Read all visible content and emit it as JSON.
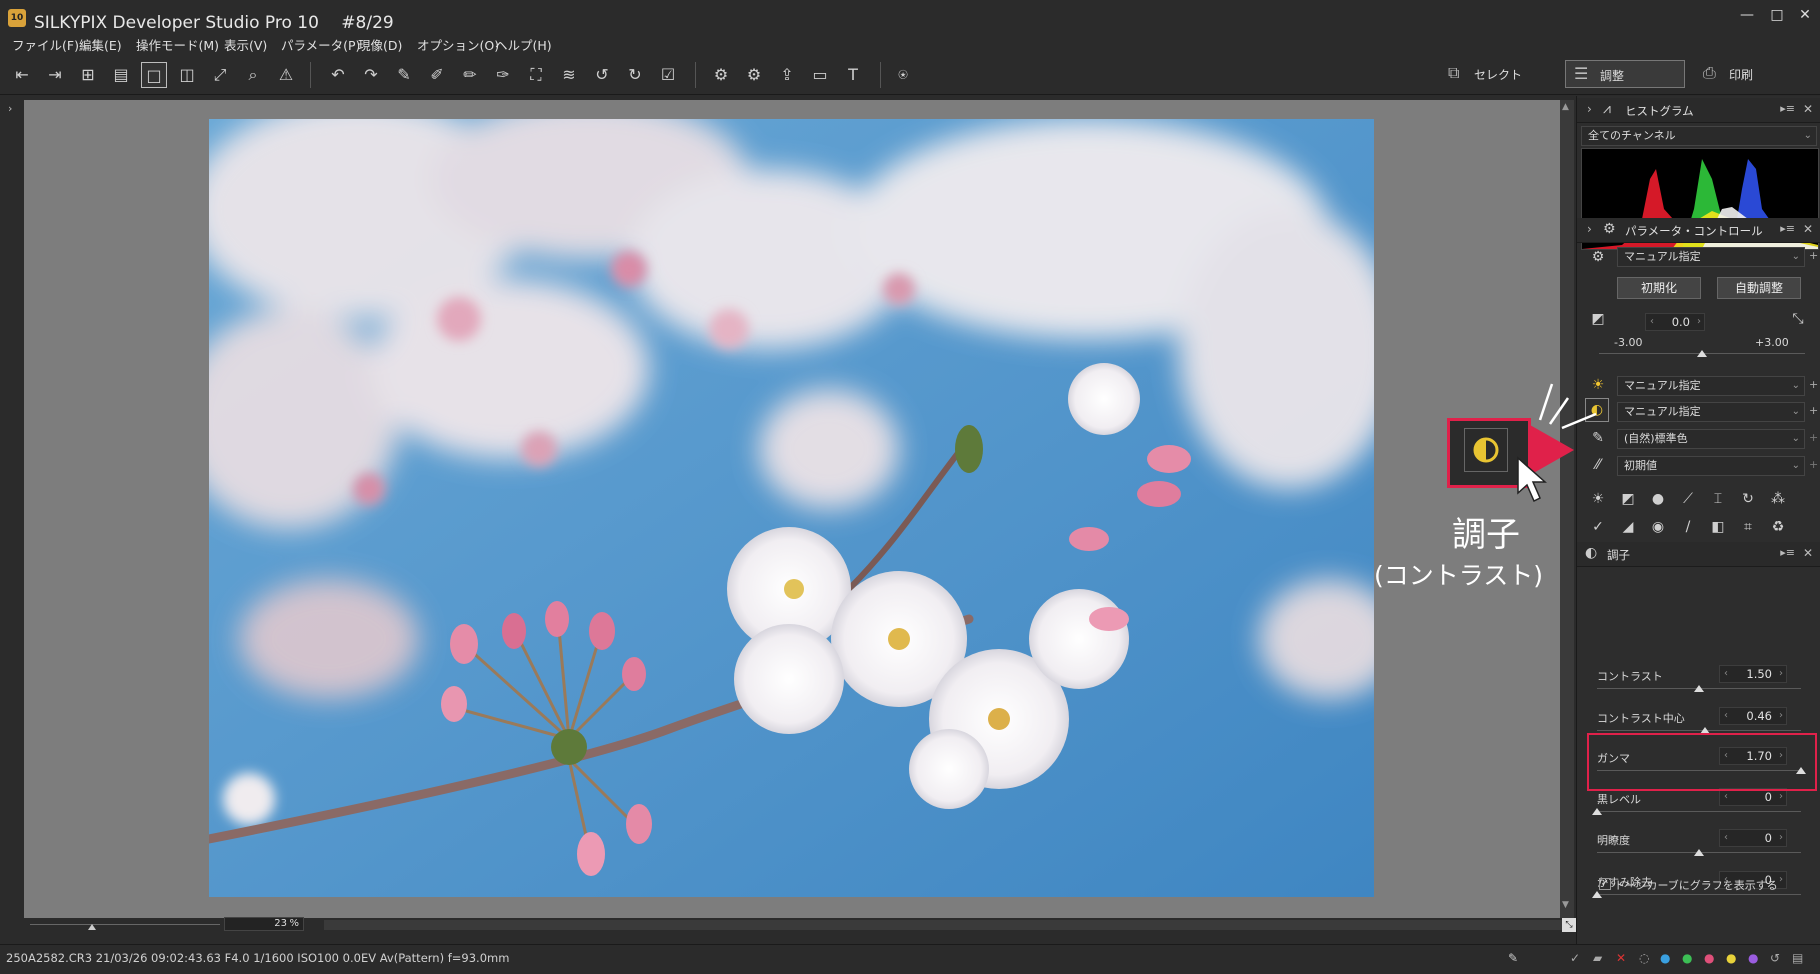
{
  "window": {
    "app_icon_text": "10",
    "title": "SILKYPIX Developer Studio Pro 10 　#8/29",
    "minimize": "—",
    "maximize": "□",
    "close": "✕"
  },
  "menubar": [
    "ファイル(F)",
    "編集(E)",
    "操作モード(M)",
    "表示(V)",
    "パラメータ(P)",
    "現像(D)",
    "オプション(O)",
    "ヘルプ(H)"
  ],
  "mode_tabs": {
    "select": "セレクト",
    "adjust": "調整",
    "print": "印刷"
  },
  "histogram": {
    "title": "ヒストグラム",
    "channel": "全てのチャンネル"
  },
  "parameter_control": {
    "title": "パラメータ・コントロール",
    "preset": "マニュアル指定",
    "reset_button": "初期化",
    "auto_button": "自動調整",
    "exposure_value": "0.0",
    "exposure_min": "-3.00",
    "exposure_max": "+3.00",
    "exposure_fraction": 0.5,
    "white_balance": "マニュアル指定",
    "tone": "マニュアル指定",
    "color": "(自然)標準色",
    "sharpness": "初期値"
  },
  "tone_panel": {
    "title": "調子",
    "sliders": [
      {
        "label": "コントラスト",
        "value": "1.50",
        "fraction": 0.5
      },
      {
        "label": "コントラスト中心",
        "value": "0.46",
        "fraction": 0.53
      },
      {
        "label": "ガンマ",
        "value": "1.70",
        "fraction": 1.0
      },
      {
        "label": "黒レベル",
        "value": "0",
        "fraction": 0.0
      },
      {
        "label": "明瞭度",
        "value": "0",
        "fraction": 0.5
      },
      {
        "label": "かすみ除去",
        "value": "0",
        "fraction": 0.0
      }
    ],
    "show_tone_curve": "トーンカーブにグラフを表示する"
  },
  "callout": {
    "label": "調子",
    "sub": "(コントラスト)"
  },
  "zoom": {
    "value": "23",
    "unit": "%"
  },
  "status": "250A2582.CR3 21/03/26 09:02:43.63 F4.0 1/1600 ISO100  0.0EV Av(Pattern) f=93.0mm",
  "colors": {
    "accent_red": "#e0214a"
  }
}
